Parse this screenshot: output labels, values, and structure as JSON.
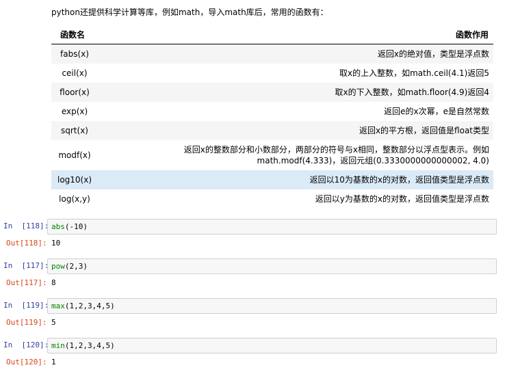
{
  "intro": "python还提供科学计算等库，例如math，导入math库后，常用的函数有：",
  "table": {
    "headers": [
      "函数名",
      "函数作用"
    ],
    "rows": [
      {
        "name": "fabs(x)",
        "desc": "返回x的绝对值，类型是浮点数"
      },
      {
        "name": "ceil(x)",
        "desc": "取x的上入整数，如math.ceil(4.1)返回5"
      },
      {
        "name": "floor(x)",
        "desc": "取x的下入整数，如math.floor(4.9)返回4"
      },
      {
        "name": "exp(x)",
        "desc": "返回e的x次幂，e是自然常数"
      },
      {
        "name": "sqrt(x)",
        "desc": "返回x的平方根，返回值是float类型"
      },
      {
        "name": "modf(x)",
        "desc": "返回x的整数部分和小数部分，两部分的符号与x相同，整数部分以浮点型表示。例如math.modf(4.333)，返回元组(0.3330000000000002, 4.0)"
      },
      {
        "name": "log10(x)",
        "desc": "返回以10为基数的x的对数，返回值类型是浮点数"
      },
      {
        "name": "log(x,y)",
        "desc": "返回以y为基数的x的对数，返回值类型是浮点数"
      }
    ]
  },
  "cells": [
    {
      "in_prompt": "In  [118]:",
      "fn": "abs",
      "args": "(-10)",
      "out_prompt": "Out[118]:",
      "output": "10"
    },
    {
      "in_prompt": "In  [117]:",
      "fn": "pow",
      "args": "(2,3)",
      "out_prompt": "Out[117]:",
      "output": "8"
    },
    {
      "in_prompt": "In  [119]:",
      "fn": "max",
      "args": "(1,2,3,4,5)",
      "out_prompt": "Out[119]:",
      "output": "5"
    },
    {
      "in_prompt": "In  [120]:",
      "fn": "min",
      "args": "(1,2,3,4,5)",
      "out_prompt": "Out[120]:",
      "output": "1"
    }
  ],
  "colors": {
    "in_prompt": "#303f9f",
    "out_prompt": "#d84315",
    "highlight_row": "#dbeaf7",
    "builtin": "#008000"
  }
}
